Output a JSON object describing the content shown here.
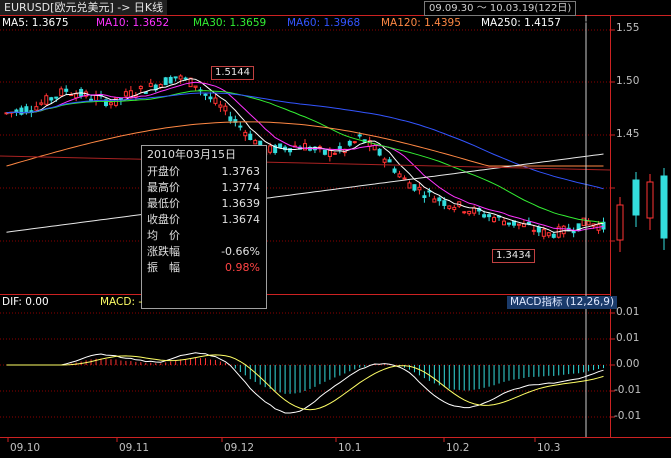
{
  "title": "EURUSD[欧元兑美元] -> 日K线",
  "date_range": "09.09.30 ～ 10.03.19(122日)",
  "ma_legend": [
    {
      "label": "MA5: 1.3675",
      "color": "#ffffff"
    },
    {
      "label": "MA10: 1.3652",
      "color": "#ff33ff"
    },
    {
      "label": "MA30: 1.3659",
      "color": "#33ee33"
    },
    {
      "label": "MA60: 1.3968",
      "color": "#3355ff"
    },
    {
      "label": "MA120: 1.4395",
      "color": "#ff8844"
    },
    {
      "label": "MA250: 1.4157",
      "color": "#ffffff"
    }
  ],
  "price_axis": [
    "1.55",
    "1.50",
    "1.45"
  ],
  "price_markers": {
    "high": "1.5144",
    "low": "1.3434"
  },
  "info_panel": {
    "date": "2010年03月15日",
    "rows": [
      {
        "label": "开盘价",
        "value": "1.3763",
        "color": "#e0e0e0"
      },
      {
        "label": "最高价",
        "value": "1.3774",
        "color": "#e0e0e0"
      },
      {
        "label": "最低价",
        "value": "1.3639",
        "color": "#e0e0e0"
      },
      {
        "label": "收盘价",
        "value": "1.3674",
        "color": "#e0e0e0"
      },
      {
        "label": "均　价",
        "value": "",
        "color": "#e0e0e0"
      },
      {
        "label": "涨跌幅",
        "value": "-0.66%",
        "color": "#e0e0e0"
      },
      {
        "label": "振　幅",
        "value": "0.98%",
        "color": "#ff4444"
      }
    ]
  },
  "macd": {
    "dif_label": "DIF: 0.00",
    "macd_label": "MACD: -",
    "indicator_title": "MACD指标 (12,26,9)",
    "axis": [
      "0.01",
      "0.01",
      "0.00",
      "-0.01",
      "-0.01"
    ]
  },
  "x_axis": [
    "09.10",
    "09.11",
    "09.12",
    "10.1",
    "10.2",
    "10.3"
  ],
  "colors": {
    "up": "#ff3333",
    "down": "#33dddd",
    "grid": "#8b0000",
    "axis": "#cc2222"
  }
}
